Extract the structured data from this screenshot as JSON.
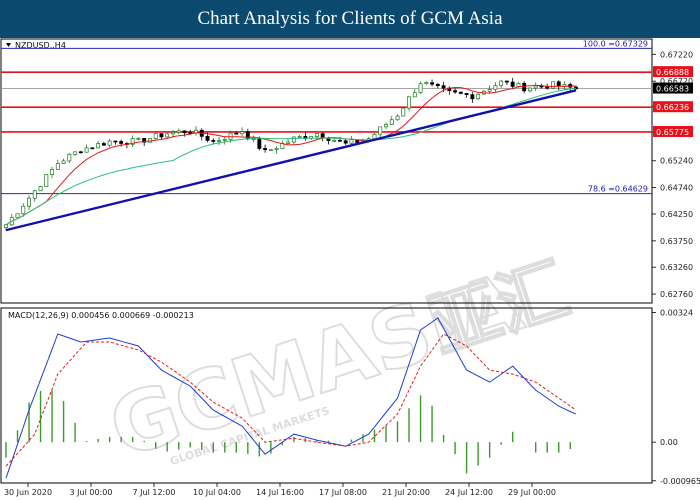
{
  "header": {
    "title": "Chart Analysis for Clients of GCM Asia"
  },
  "watermark": {
    "brand": "GCMASIA",
    "cjk": "亚汇",
    "tagline": "GLOBAL CAPITAL MARKETS"
  },
  "colors": {
    "bull_candle": "#1a7a1a",
    "bear_candle": "#000000",
    "ma_fast": "#e8171a",
    "ma_slow": "#2bbf7a",
    "trendline": "#1010b0",
    "level_red": "#e8101a",
    "fibo_line": "#2a2ab0",
    "macd_line": "#1a3fd0",
    "signal_line": "#e81a1a",
    "histogram": "#3a9a2a"
  },
  "chart_data": [
    {
      "type": "candlestick",
      "title": "NZDUSD,,H4",
      "ylim": [
        0.6265,
        0.6743
      ],
      "y_ticks": [
        "0.67220",
        "0.66720",
        "0.66250",
        "0.65770",
        "0.65240",
        "0.64740",
        "0.64250",
        "0.63750",
        "0.63260",
        "0.62760"
      ],
      "x_labels": [
        "30 Jun 2020",
        "3 Jul 00:00",
        "7 Jul 12:00",
        "10 Jul 04:00",
        "14 Jul 16:00",
        "17 Jul 08:00",
        "21 Jul 20:00",
        "24 Jul 12:00",
        "29 Jul 00:00"
      ],
      "current_price": "0.66583",
      "horizontal_levels": [
        {
          "name": "resistance",
          "value": 0.66888,
          "label": "0.66888"
        },
        {
          "name": "support-1",
          "value": 0.66236,
          "label": "0.66236"
        },
        {
          "name": "support-2",
          "value": 0.65775,
          "label": "0.65775"
        }
      ],
      "fibonacci": [
        {
          "level": "100.0",
          "value": 0.67329,
          "label": "100.0 =0.67329"
        },
        {
          "level": "78.6",
          "value": 0.64629,
          "label": "78.6 =0.64629"
        }
      ],
      "trendline": {
        "from": {
          "bar": 0,
          "price": 0.6395
        },
        "to": {
          "bar": 99,
          "price": 0.6655
        }
      },
      "close_path": [
        [
          0,
          0.6405
        ],
        [
          4,
          0.6455
        ],
        [
          9,
          0.652
        ],
        [
          13,
          0.6545
        ],
        [
          18,
          0.656
        ],
        [
          23,
          0.656
        ],
        [
          28,
          0.6575
        ],
        [
          32,
          0.658
        ],
        [
          36,
          0.656
        ],
        [
          41,
          0.658
        ],
        [
          45,
          0.654
        ],
        [
          50,
          0.6565
        ],
        [
          54,
          0.6575
        ],
        [
          59,
          0.6555
        ],
        [
          63,
          0.6565
        ],
        [
          68,
          0.661
        ],
        [
          72,
          0.667
        ],
        [
          77,
          0.665
        ],
        [
          81,
          0.6645
        ],
        [
          86,
          0.667
        ],
        [
          90,
          0.666
        ],
        [
          95,
          0.6665
        ],
        [
          99,
          0.6658
        ]
      ]
    },
    {
      "type": "macd",
      "title": "MACD(12,26,9) 0.000456 0.000669 -0.000213",
      "params": "12,26,9",
      "values": {
        "macd": 0.000456,
        "signal": 0.000669,
        "histogram": -0.000213
      },
      "ylim": [
        -0.00097,
        0.00325
      ],
      "y_ticks": [
        "0.00324",
        "0.00",
        "-0.000965"
      ],
      "macd_path": [
        [
          0,
          -0.0009
        ],
        [
          4,
          0.0008
        ],
        [
          9,
          0.0027
        ],
        [
          13,
          0.0025
        ],
        [
          18,
          0.0026
        ],
        [
          23,
          0.0024
        ],
        [
          27,
          0.0018
        ],
        [
          32,
          0.0014
        ],
        [
          36,
          0.0008
        ],
        [
          41,
          0.0004
        ],
        [
          45,
          -0.0003
        ],
        [
          50,
          0.0002
        ],
        [
          54,
          5e-05
        ],
        [
          59,
          -0.0001
        ],
        [
          63,
          0.0002
        ],
        [
          68,
          0.0011
        ],
        [
          72,
          0.0028
        ],
        [
          75,
          0.0031
        ],
        [
          80,
          0.0018
        ],
        [
          84,
          0.0015
        ],
        [
          88,
          0.0019
        ],
        [
          92,
          0.0013
        ],
        [
          96,
          0.0009
        ],
        [
          99,
          0.0007
        ]
      ],
      "signal_path": [
        [
          0,
          -0.0006
        ],
        [
          5,
          0.0002
        ],
        [
          9,
          0.0017
        ],
        [
          14,
          0.0025
        ],
        [
          18,
          0.0025
        ],
        [
          23,
          0.0023
        ],
        [
          27,
          0.002
        ],
        [
          32,
          0.0015
        ],
        [
          36,
          0.001
        ],
        [
          41,
          0.0006
        ],
        [
          45,
          0.0
        ],
        [
          50,
          0.0001
        ],
        [
          54,
          0.0
        ],
        [
          59,
          -0.0001
        ],
        [
          63,
          0.0
        ],
        [
          68,
          0.0007
        ],
        [
          72,
          0.0019
        ],
        [
          76,
          0.0027
        ],
        [
          80,
          0.0024
        ],
        [
          84,
          0.0018
        ],
        [
          88,
          0.0017
        ],
        [
          92,
          0.0015
        ],
        [
          96,
          0.0011
        ],
        [
          99,
          0.0008
        ]
      ]
    }
  ]
}
